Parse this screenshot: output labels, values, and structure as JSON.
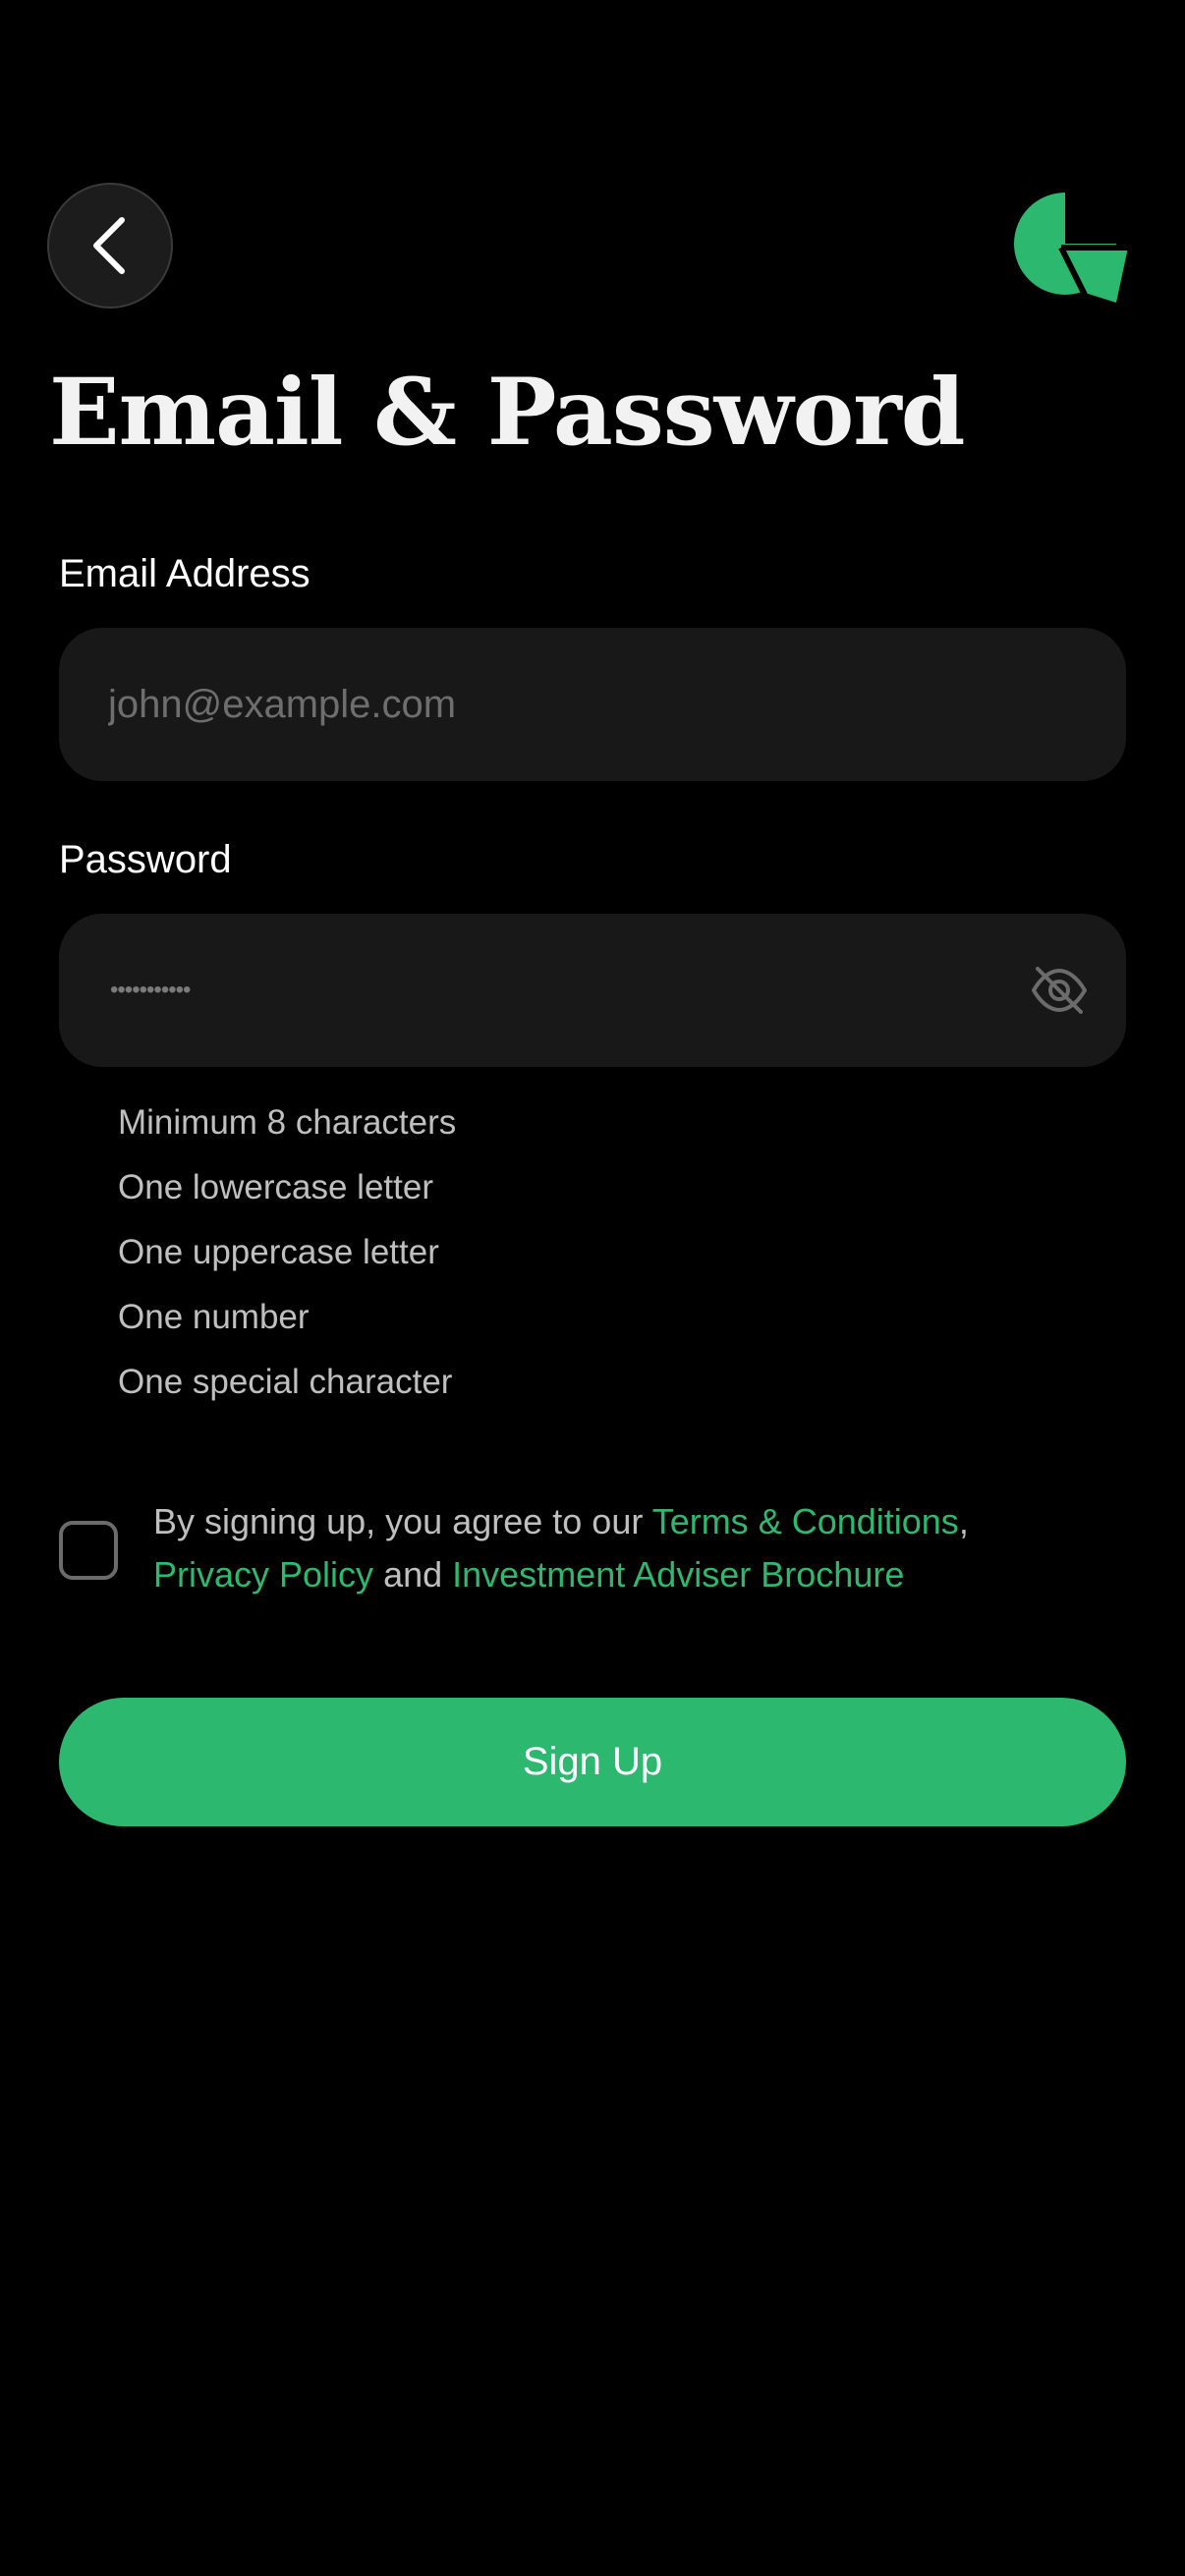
{
  "header": {
    "back_icon": "chevron-left-icon",
    "logo_icon": "brand-logo-icon",
    "brand_color": "#2DB86F"
  },
  "page": {
    "title": "Email & Password"
  },
  "form": {
    "email": {
      "label": "Email Address",
      "value": "",
      "placeholder": "john@example.com"
    },
    "password": {
      "label": "Password",
      "masked_value": "•••••••••••",
      "toggle_icon": "eye-off-icon"
    },
    "requirements": [
      "Minimum 8 characters",
      "One lowercase letter",
      "One uppercase letter",
      "One number",
      "One special character"
    ]
  },
  "agreement": {
    "checked": false,
    "prefix": "By signing up, you agree to our ",
    "terms_link": "Terms & Conditions",
    "comma": ",",
    "privacy_link": "Privacy Policy",
    "and": " and ",
    "brochure_link": "Investment Adviser Brochure"
  },
  "actions": {
    "signup_label": "Sign Up"
  },
  "colors": {
    "background": "#000000",
    "field_background": "#181818",
    "accent": "#2DB86F",
    "muted_text": "#BFBFBF"
  }
}
